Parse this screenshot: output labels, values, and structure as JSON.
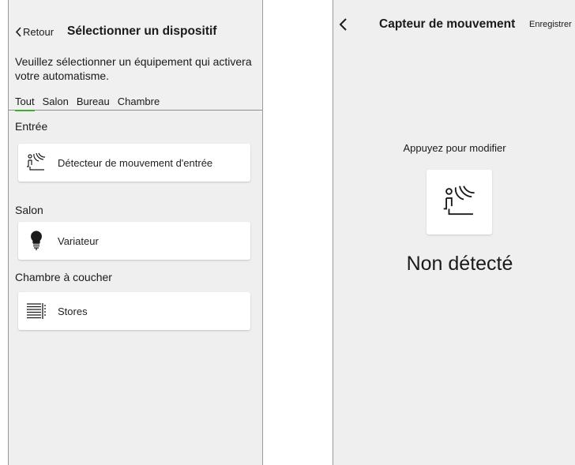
{
  "left": {
    "back_label": "Retour",
    "title": "Sélectionner un dispositif",
    "instruction": "Veuillez sélectionner un équipement qui activera votre automatisme.",
    "tabs": [
      {
        "label": "Tout"
      },
      {
        "label": "Salon"
      },
      {
        "label": "Bureau"
      },
      {
        "label": "Chambre"
      }
    ],
    "active_tab": "Tout",
    "sections": [
      {
        "title": "Entrée",
        "device": {
          "label": "Détecteur de mouvement d'entrée",
          "icon": "motion-sensor-icon"
        }
      },
      {
        "title": "Salon",
        "device": {
          "label": "Variateur",
          "icon": "bulb-icon"
        }
      },
      {
        "title": "Chambre à coucher",
        "device": {
          "label": "Stores",
          "icon": "blinds-icon"
        }
      }
    ]
  },
  "right": {
    "title": "Capteur de mouvement",
    "save_label": "Enregistrer",
    "hint": "Appuyez pour modifier",
    "icon": "motion-sensor-icon",
    "status": "Non détecté"
  },
  "colors": {
    "accent": "#3dae2b",
    "background": "#efefef",
    "card": "#ffffff"
  }
}
